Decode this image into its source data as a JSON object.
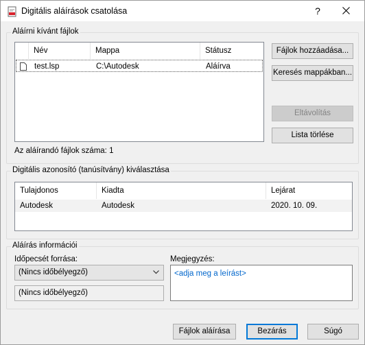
{
  "window": {
    "title": "Digitális aláírások csatolása",
    "help_label": "?",
    "colors": {
      "accent": "#0078d7",
      "selection": "#e5f3ff"
    }
  },
  "files_group": {
    "legend": "Aláírni kívánt fájlok",
    "columns": [
      "Név",
      "Mappa",
      "Státusz"
    ],
    "rows": [
      {
        "name": "test.lsp",
        "folder": "C:\\Autodesk",
        "status": "Aláírva",
        "icon": "file-icon"
      }
    ],
    "buttons": {
      "add": "Fájlok hozzáadása...",
      "search": "Keresés mappákban...",
      "remove": "Eltávolítás",
      "clear": "Lista törlése"
    },
    "count_label": "Az aláírandó fájlok száma: 1"
  },
  "cert_group": {
    "legend": "Digitális azonosító (tanúsítvány) kiválasztása",
    "columns": [
      "Tulajdonos",
      "Kiadta",
      "Lejárat"
    ],
    "rows": [
      {
        "owner": "Autodesk",
        "issuer": "Autodesk",
        "expires": "2020. 10. 09."
      }
    ]
  },
  "sig_group": {
    "legend": "Aláírás információi",
    "timestamp_label": "Időpecsét forrása:",
    "timestamp_value": "(Nincs időbélyegző)",
    "timestamp_readonly": "(Nincs időbélyegző)",
    "comment_label": "Megjegyzés:",
    "comment_placeholder": "<adja meg a leírást>"
  },
  "footer": {
    "sign": "Fájlok aláírása",
    "close": "Bezárás",
    "help": "Súgó"
  }
}
